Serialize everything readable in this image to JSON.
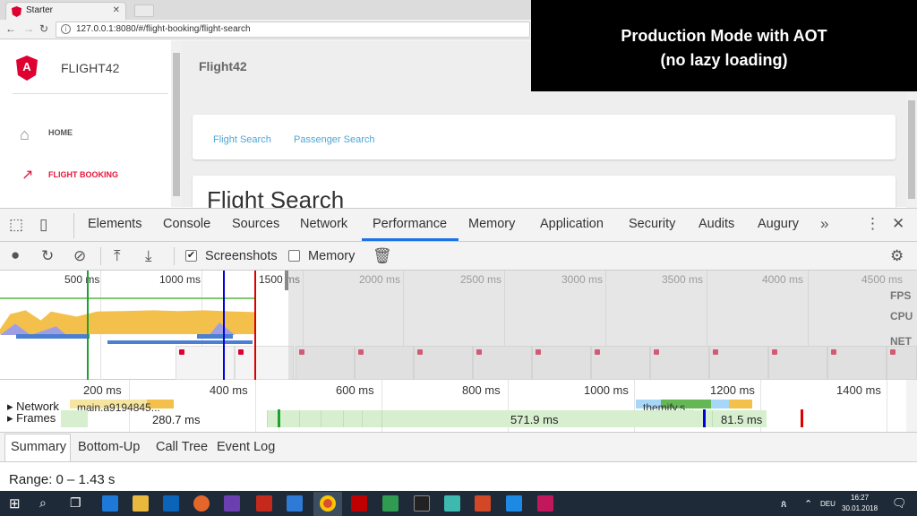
{
  "browser": {
    "tab_title": "Starter",
    "url": "127.0.0.1:8080/#/flight-booking/flight-search"
  },
  "app": {
    "brand": "FLIGHT42",
    "header_title": "Flight42",
    "nav_home": "HOME",
    "nav_flight_booking": "FLIGHT BOOKING",
    "link_flight_search": "Flight Search",
    "link_passenger_search": "Passenger Search",
    "page_heading": "Flight Search"
  },
  "overlay": {
    "line1": "Production Mode with AOT",
    "line2": "(no lazy loading)"
  },
  "devtools": {
    "tabs": [
      "Elements",
      "Console",
      "Sources",
      "Network",
      "Performance",
      "Memory",
      "Application",
      "Security",
      "Audits",
      "Augury"
    ],
    "selected_tab": "Performance",
    "toolbar": {
      "screenshots_label": "Screenshots",
      "screenshots_checked": true,
      "memory_label": "Memory",
      "memory_checked": false
    },
    "overview": {
      "ticks": [
        "500 ms",
        "1000 ms",
        "1500 ms",
        "2000 ms",
        "2500 ms",
        "3000 ms",
        "3500 ms",
        "4000 ms",
        "4500 ms"
      ],
      "labels": [
        "FPS",
        "CPU",
        "NET"
      ]
    },
    "flame": {
      "ticks": [
        "200 ms",
        "400 ms",
        "600 ms",
        "800 ms",
        "1000 ms",
        "1200 ms",
        "1400 ms"
      ],
      "network_label": "Network",
      "network_item1": "main.a9194845...",
      "network_item2": "themify.s...",
      "frames_label": "Frames",
      "frames": [
        "280.7 ms",
        "571.9 ms",
        "81.5 ms"
      ]
    },
    "bottom_tabs": [
      "Summary",
      "Bottom-Up",
      "Call Tree",
      "Event Log"
    ],
    "selected_bottom_tab": "Summary",
    "range": "Range: 0 – 1.43 s"
  },
  "taskbar": {
    "lang": "DEU",
    "time": "16:27",
    "date": "30.01.2018"
  },
  "colors": {
    "angular_red": "#dd0031",
    "link_blue": "#4fa6d6",
    "cpu_yellow": "#f3c04c",
    "frame_green": "#d7efcf"
  }
}
